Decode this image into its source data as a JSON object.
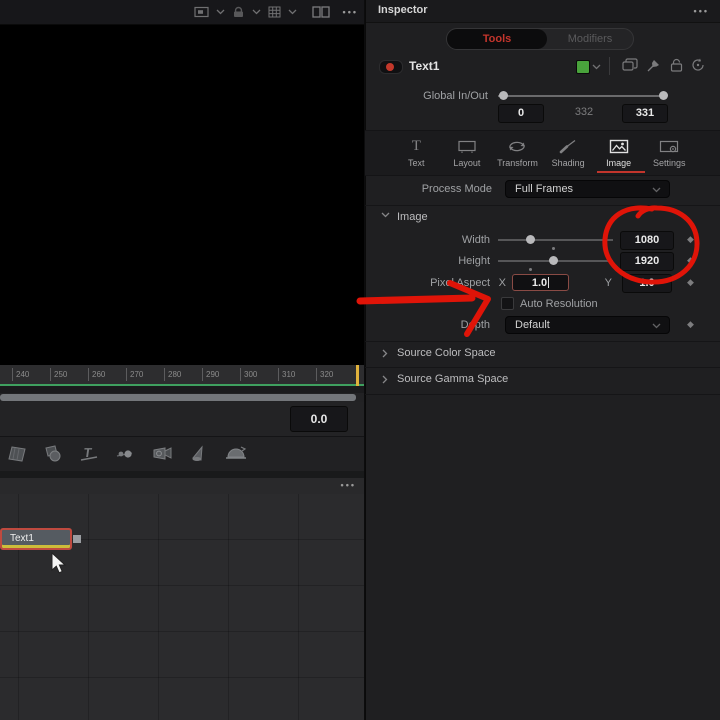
{
  "viewer": {
    "toolbar_icons": [
      "display-icon",
      "chevron-down-icon",
      "lock-icon",
      "chevron-down-icon",
      "grid-icon",
      "chevron-down-icon",
      "split-view-icon",
      "overflow-menu-icon"
    ],
    "menu_glyph": "•••"
  },
  "timeline": {
    "ticks": [
      "240",
      "250",
      "260",
      "270",
      "280",
      "290",
      "300",
      "310",
      "320"
    ],
    "value_box": "0.0"
  },
  "toolbar_3d": {
    "icons": [
      "imageplane3d-icon",
      "shape3d-icon",
      "text3d-icon",
      "merge3d-icon",
      "camera3d-icon",
      "spotlight3d-icon",
      "renderer3d-icon"
    ]
  },
  "node_editor": {
    "menu_glyph": "•••",
    "node": {
      "label": "Text1"
    }
  },
  "inspector": {
    "title": "Inspector",
    "menu_glyph": "•••",
    "mode_tabs": {
      "tools": "Tools",
      "modifiers": "Modifiers"
    },
    "header": {
      "node_name": "Text1"
    },
    "global_in_out": {
      "label": "Global In/Out",
      "in": "0",
      "mid": "332",
      "out": "331"
    },
    "tool_tabs": [
      {
        "label": "Text"
      },
      {
        "label": "Layout"
      },
      {
        "label": "Transform"
      },
      {
        "label": "Shading"
      },
      {
        "label": "Image"
      },
      {
        "label": "Settings"
      }
    ],
    "active_tool_tab": "Image",
    "process_mode": {
      "label": "Process Mode",
      "value": "Full Frames"
    },
    "image": {
      "title": "Image",
      "width": {
        "label": "Width",
        "value": "1080"
      },
      "height": {
        "label": "Height",
        "value": "1920"
      },
      "pixel_aspect": {
        "label": "Pixel Aspect",
        "x_label": "X",
        "x_value": "1.0",
        "y_label": "Y",
        "y_value": "1.0"
      },
      "auto_resolution_label": "Auto Resolution",
      "depth": {
        "label": "Depth",
        "value": "Default"
      }
    },
    "collapsed_sections": [
      {
        "label": "Source Color Space"
      },
      {
        "label": "Source Gamma Space"
      }
    ]
  },
  "colors": {
    "accent_red": "#c3352c",
    "annotation_red": "#e01408",
    "node_color_swatch": "#49a33c",
    "range_green": "#3fa05f",
    "playhead_orange": "#e0b23c"
  }
}
